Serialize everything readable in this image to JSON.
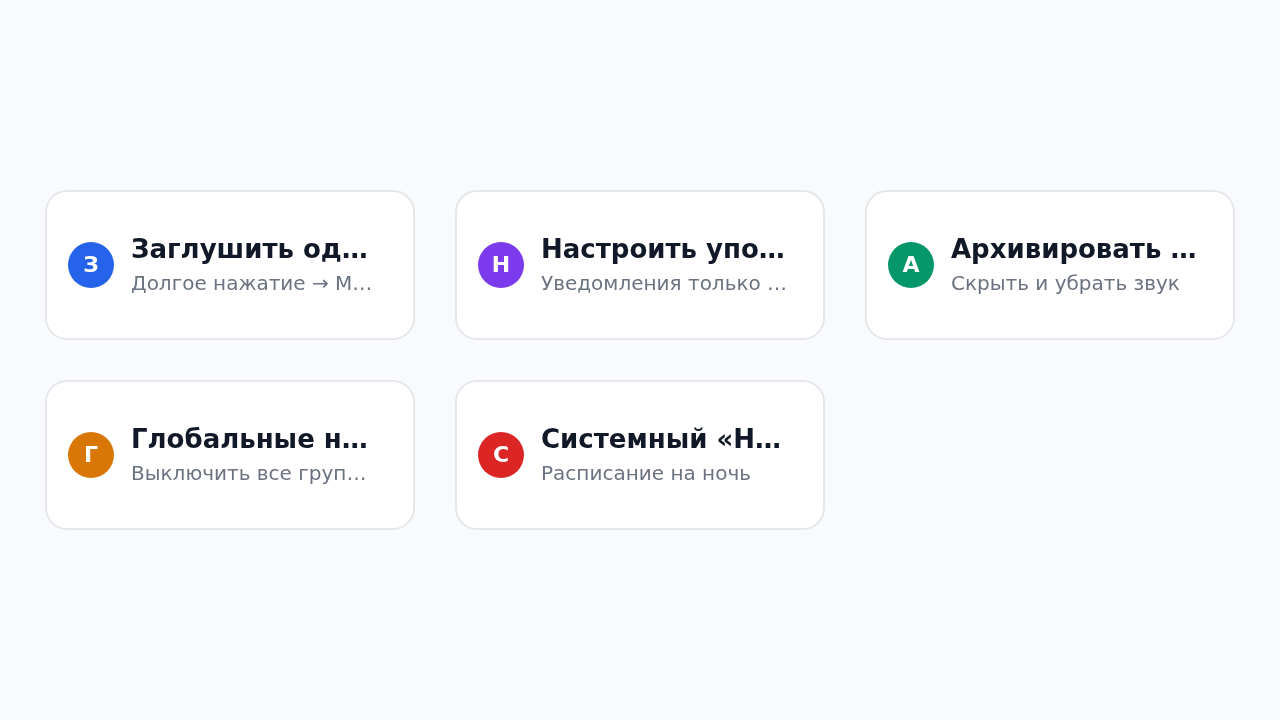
{
  "options": [
    {
      "initial": "З",
      "title": "Заглушить од…",
      "subtitle": "Долгое нажатие → М…",
      "color": "#2563eb"
    },
    {
      "initial": "Н",
      "title": "Настроить упо…",
      "subtitle": "Уведомления только …",
      "color": "#7c3aed"
    },
    {
      "initial": "А",
      "title": "Архивировать …",
      "subtitle": "Скрыть и убрать звук",
      "color": "#059669"
    },
    {
      "initial": "Г",
      "title": "Глобальные н…",
      "subtitle": "Выключить все груп…",
      "color": "#d97706"
    },
    {
      "initial": "С",
      "title": "Системный «Н…",
      "subtitle": "Расписание на ночь",
      "color": "#dc2626"
    }
  ]
}
